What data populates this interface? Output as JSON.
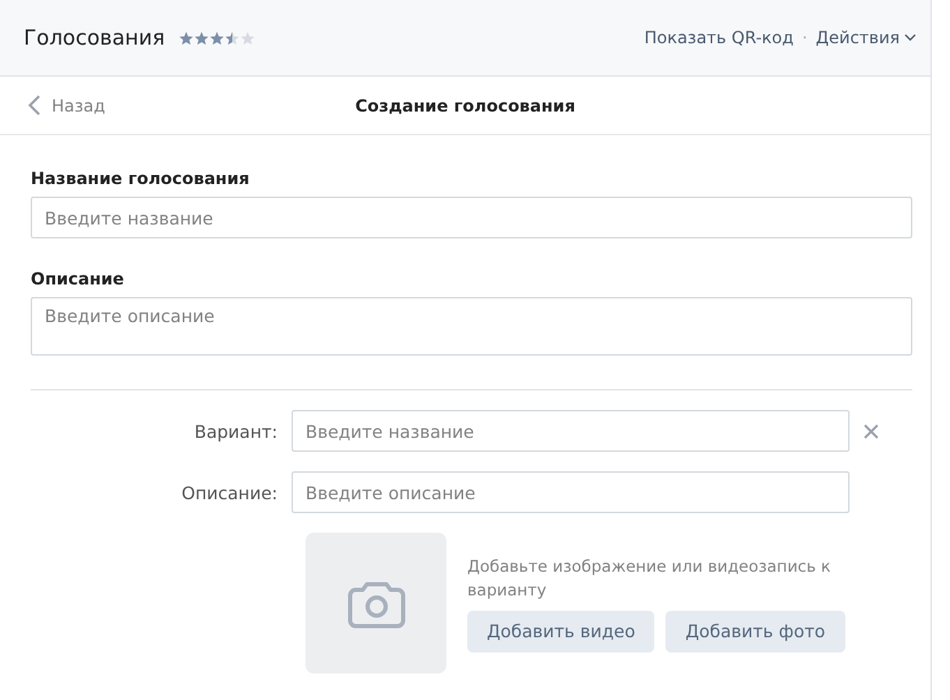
{
  "header": {
    "title": "Голосования",
    "stars": 3.5,
    "links": [
      "Показать QR-код",
      "Действия"
    ],
    "separator": "·"
  },
  "nav": {
    "back": "Назад",
    "title": "Создание голосования"
  },
  "poll": {
    "name_label": "Название голосования",
    "name_placeholder": "Введите название",
    "description_label": "Описание",
    "description_placeholder": "Введите описание"
  },
  "variant": {
    "name_label": "Вариант:",
    "name_placeholder": "Введите название",
    "description_label": "Описание:",
    "description_placeholder": "Введите описание",
    "media_hint": "Добавьте изображение или видеозапись к варианту",
    "buttons": [
      "Добавить видео",
      "Добавить фото"
    ]
  }
}
